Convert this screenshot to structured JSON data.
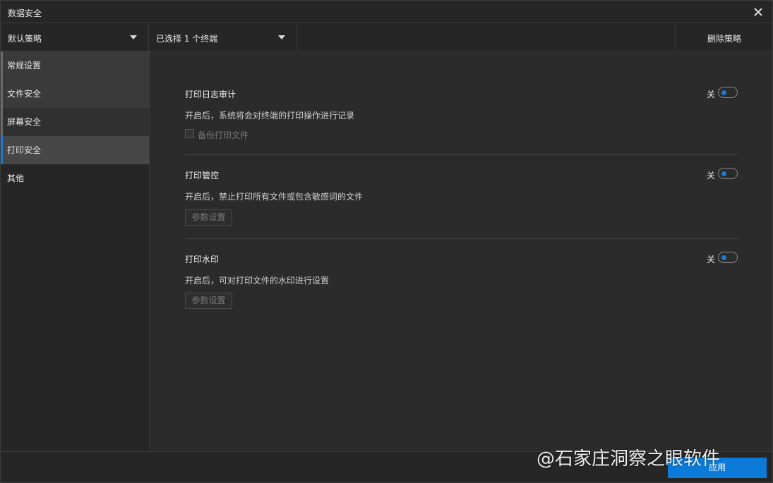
{
  "window": {
    "title": "数据安全"
  },
  "toolbar": {
    "policy_select": "默认策略",
    "terminal_select": "已选择 1 个终端",
    "delete_label": "删除策略"
  },
  "sidebar": {
    "items": [
      {
        "label": "常规设置"
      },
      {
        "label": "文件安全"
      },
      {
        "label": "屏幕安全"
      },
      {
        "label": "打印安全"
      },
      {
        "label": "其他"
      }
    ],
    "active_index": 3
  },
  "sections": [
    {
      "title": "打印日志审计",
      "description": "开启后，系统将会对终端的打印操作进行记录",
      "toggle_label": "关",
      "checkbox_label": "备份打印文件"
    },
    {
      "title": "打印管控",
      "description": "开启后，禁止打印所有文件或包含敏感词的文件",
      "toggle_label": "关",
      "button_label": "参数设置"
    },
    {
      "title": "打印水印",
      "description": "开启后，可对打印文件的水印进行设置",
      "toggle_label": "关",
      "button_label": "参数设置"
    }
  ],
  "footer": {
    "apply_label": "应用"
  },
  "overlay": {
    "watermark_text": "@石家庄洞察之眼软件"
  },
  "colors": {
    "accent": "#1e78d0",
    "apply_button": "#0b7ad8"
  }
}
